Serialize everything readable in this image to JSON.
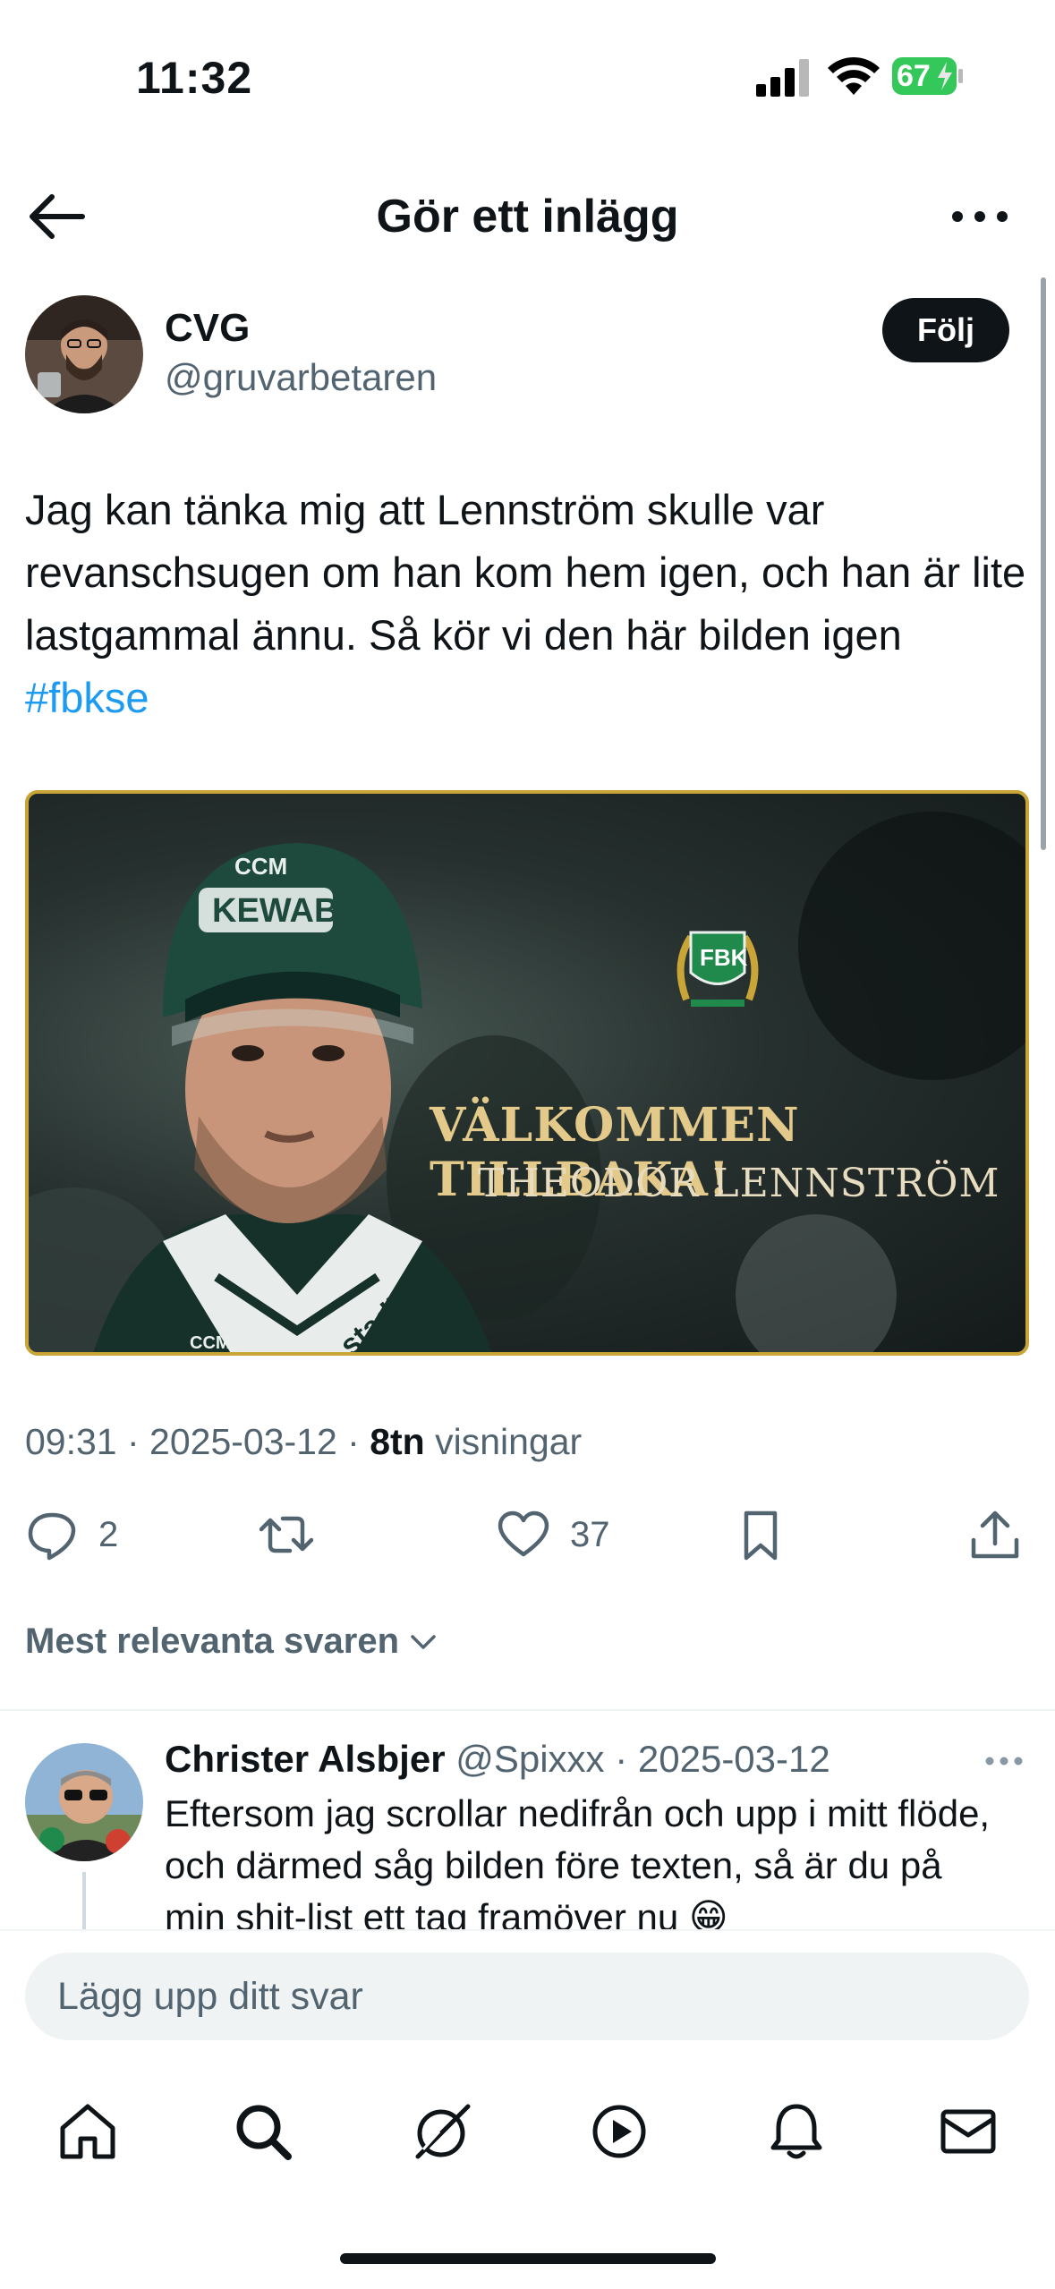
{
  "status_bar": {
    "time": "11:32",
    "battery": "67"
  },
  "header": {
    "title": "Gör ett inlägg"
  },
  "post": {
    "author_name": "CVG",
    "author_handle": "@gruvarbetaren",
    "follow_label": "Följ",
    "text": "Jag kan tänka mig att Lennström skulle var revanschsugen om han kom hem igen, och han är lite lastgammal ännu. Så kör vi den här bilden igen ",
    "hashtag": "#fbkse",
    "media": {
      "line1": "VÄLKOMMEN TILLBAKA!",
      "line2": "THEODOR LENNSTRÖM",
      "helmet_text": "KEWAB",
      "helmet_brand": "CCM",
      "club_badge": "FBK",
      "jersey_text": "stadium",
      "border_color": "#c9a437"
    },
    "time": "09:31",
    "date": "2025-03-12",
    "views_count": "8tn",
    "views_label": "visningar",
    "replies": "2",
    "likes": "37"
  },
  "replies_sort": {
    "label": "Mest relevanta svaren"
  },
  "reply": {
    "name": "Christer Alsbjer",
    "handle": "@Spixxx",
    "date": "2025-03-12",
    "text": "Eftersom jag scrollar nedifrån och upp i mitt flöde, och därmed såg bilden före texten, så är du på min shit-list ett tag framöver nu 😁"
  },
  "compose": {
    "placeholder": "Lägg upp ditt svar"
  },
  "nav": [
    "home-icon",
    "search-icon",
    "grok-icon",
    "video-icon",
    "notifications-icon",
    "messages-icon"
  ],
  "colors": {
    "accent": "#1d9bf0",
    "text": "#0f1419",
    "secondary": "#536471",
    "battery": "#34c759"
  }
}
